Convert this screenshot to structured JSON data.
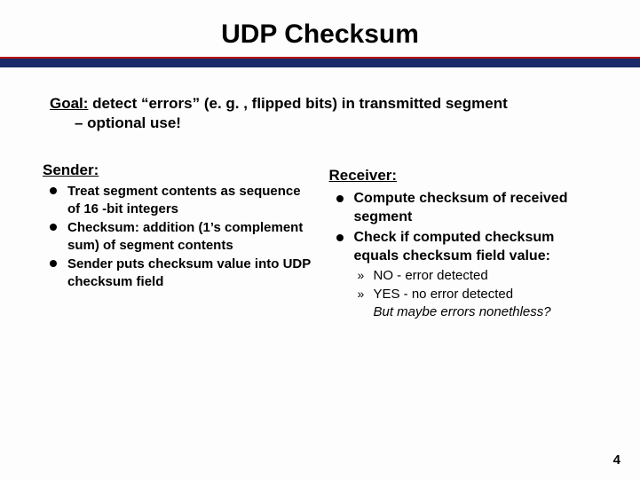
{
  "title": "UDP Checksum",
  "goal": {
    "label": "Goal:",
    "line1": " detect “errors” (e. g. , flipped bits) in transmitted segment",
    "line2": "– optional use!"
  },
  "sender": {
    "heading": "Sender:",
    "items": [
      "Treat segment contents as sequence of 16 -bit integers",
      "Checksum: addition (1’s complement sum) of segment contents",
      "Sender puts checksum value into UDP checksum field"
    ]
  },
  "receiver": {
    "heading": "Receiver:",
    "items": [
      "Compute checksum of received segment",
      "Check if computed checksum equals checksum field value:"
    ],
    "sub": [
      "NO - error detected",
      "YES - no error detected",
      "But maybe errors nonethless?"
    ]
  },
  "page": "4"
}
